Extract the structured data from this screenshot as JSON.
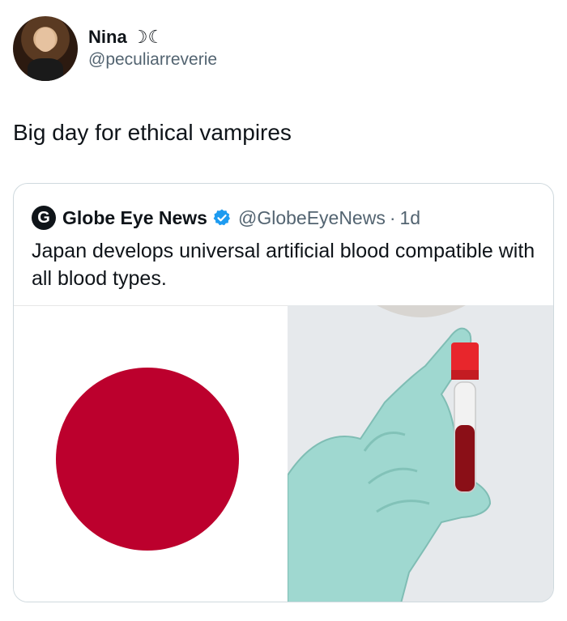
{
  "post": {
    "author_name": "Nina ☽☾",
    "author_handle": "@peculiarreverie",
    "text": "Big day for ethical vampires"
  },
  "quoted": {
    "logo_letter": "G",
    "name": "Globe Eye News",
    "handle": "@GlobeEyeNews",
    "separator": "·",
    "time": "1d",
    "text": "Japan develops universal artificial blood compatible with all blood types.",
    "verified_color": "#1d9bf0"
  },
  "colors": {
    "flag_red": "#bc002d",
    "glove": "#9fd8d0",
    "tube_cap": "#e8262c",
    "blood": "#8a0f17"
  }
}
